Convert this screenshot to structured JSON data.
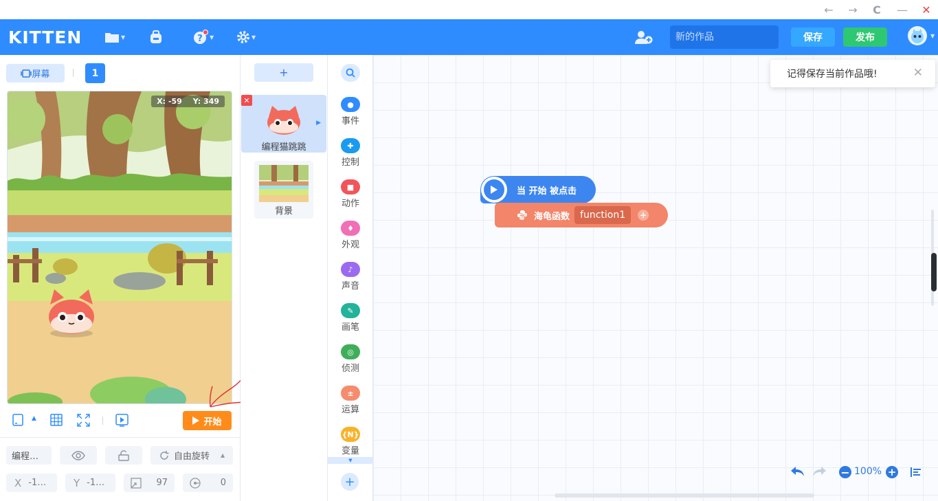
{
  "window": {
    "back": "←",
    "forward": "→",
    "reload": "C",
    "minimize": "—",
    "close": "✕"
  },
  "header": {
    "logo": "KITTEN",
    "work_title_placeholder": "新的作品",
    "save_label": "保存",
    "publish_label": "发布",
    "icons": [
      "folder-icon",
      "backpack-icon",
      "help-icon",
      "settings-icon",
      "add-user-icon",
      "user-avatar"
    ]
  },
  "stage_panel": {
    "screen_label": "屏幕",
    "screen_count": "1",
    "coords": {
      "x_label": "X: -59",
      "y_label": "Y: 349"
    },
    "start_label": "开始",
    "sprite_name_short": "编程…",
    "rotation_label": "自由旋转",
    "x_label": "X",
    "x_value": "-1…",
    "y_label": "Y",
    "y_value": "-1…",
    "size_value": "97",
    "direction_value": "0"
  },
  "sprites": {
    "add_label": "+",
    "items": [
      {
        "name": "编程猫跳跳"
      }
    ],
    "background_label": "背景"
  },
  "palette": {
    "categories": [
      {
        "label": "事件",
        "color": "#2f8cff",
        "icon": "event-icon"
      },
      {
        "label": "控制",
        "color": "#1a9bf0",
        "icon": "control-icon"
      },
      {
        "label": "动作",
        "color": "#f2545b",
        "icon": "motion-icon"
      },
      {
        "label": "外观",
        "color": "#f06fb6",
        "icon": "looks-icon"
      },
      {
        "label": "声音",
        "color": "#9b6af0",
        "icon": "sound-icon"
      },
      {
        "label": "画笔",
        "color": "#22b39a",
        "icon": "pen-icon"
      },
      {
        "label": "侦测",
        "color": "#3fae5a",
        "icon": "sensing-icon"
      },
      {
        "label": "运算",
        "color": "#f58c6e",
        "icon": "operator-icon"
      },
      {
        "label": "变量",
        "color": "#f8b22a",
        "icon": "variable-icon"
      }
    ],
    "add_label": "+"
  },
  "workspace": {
    "toast": "记得保存当前作品哦!",
    "hat_block": "当 开始 被点击",
    "func_block": "海龟函数",
    "func_name": "function1",
    "zoom": "100%"
  }
}
